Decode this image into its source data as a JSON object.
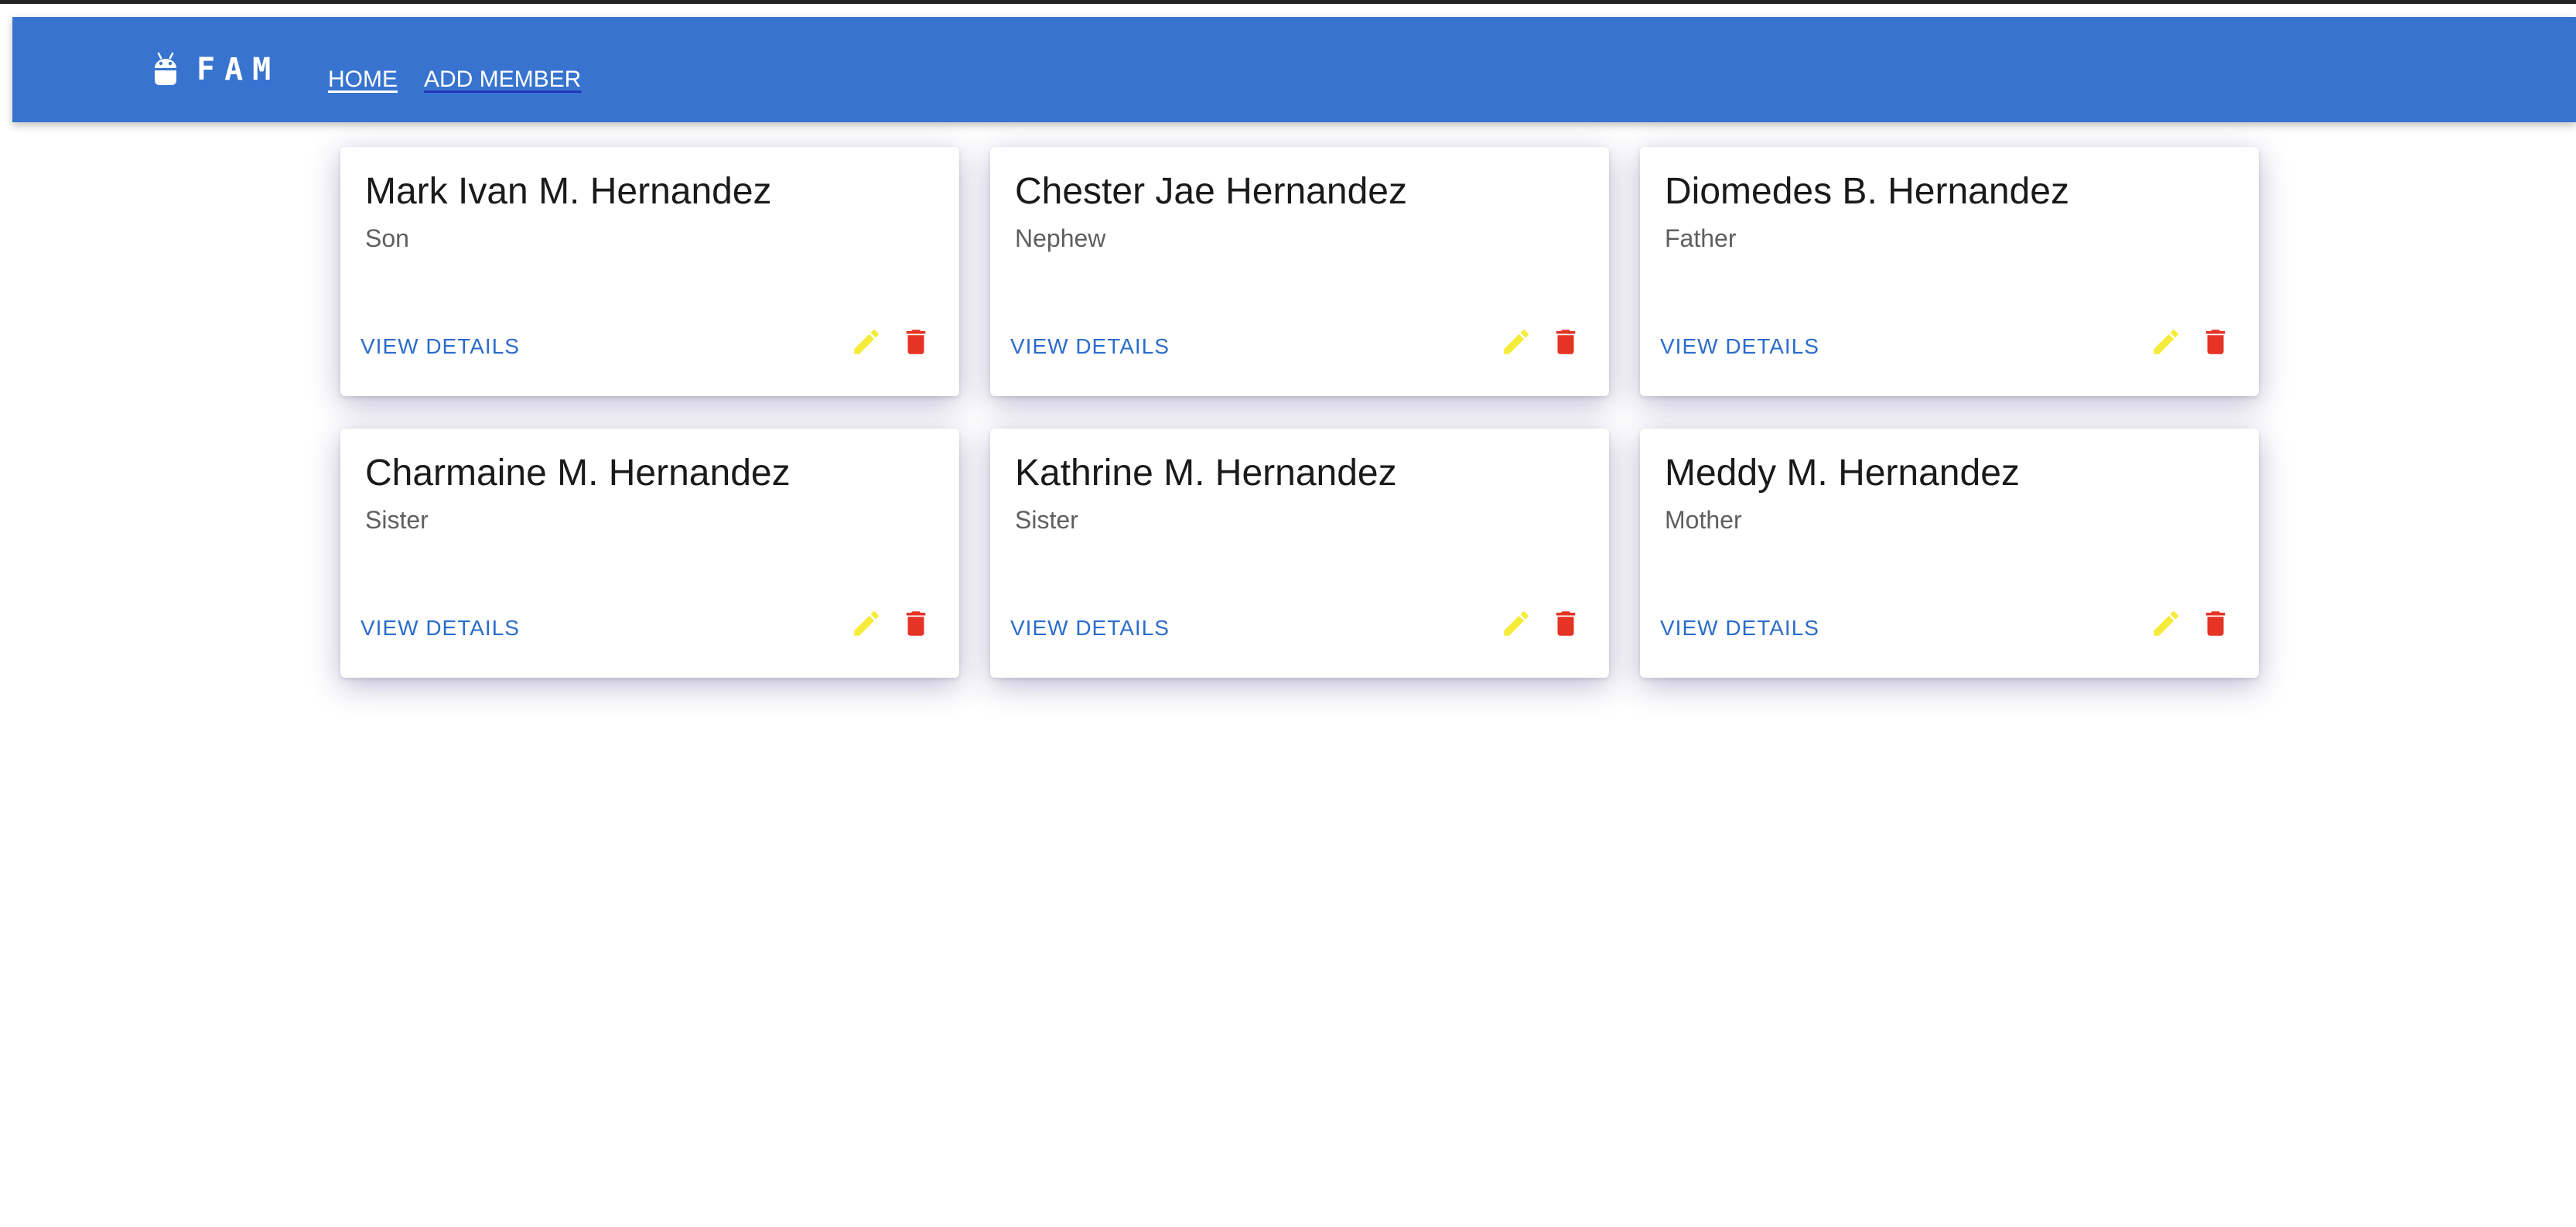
{
  "navbar": {
    "brand": "FAM",
    "brand_icon": "android-icon",
    "links": [
      {
        "label": "HOME"
      },
      {
        "label": "ADD MEMBER"
      }
    ],
    "background": "#3874cf"
  },
  "members": [
    {
      "name": "Mark Ivan M. Hernandez",
      "relation": "Son",
      "action": "VIEW DETAILS"
    },
    {
      "name": "Chester Jae Hernandez",
      "relation": "Nephew",
      "action": "VIEW DETAILS"
    },
    {
      "name": "Diomedes B. Hernandez",
      "relation": "Father",
      "action": "VIEW DETAILS"
    },
    {
      "name": "Charmaine M. Hernandez",
      "relation": "Sister",
      "action": "VIEW DETAILS"
    },
    {
      "name": "Kathrine M. Hernandez",
      "relation": "Sister",
      "action": "VIEW DETAILS"
    },
    {
      "name": "Meddy M. Hernandez",
      "relation": "Mother",
      "action": "VIEW DETAILS"
    }
  ],
  "icons": {
    "edit": "pencil-icon",
    "delete": "trash-icon"
  },
  "colors": {
    "edit_icon": "#f5ec3a",
    "delete_icon": "#e53325",
    "link": "#2b6ccc"
  }
}
